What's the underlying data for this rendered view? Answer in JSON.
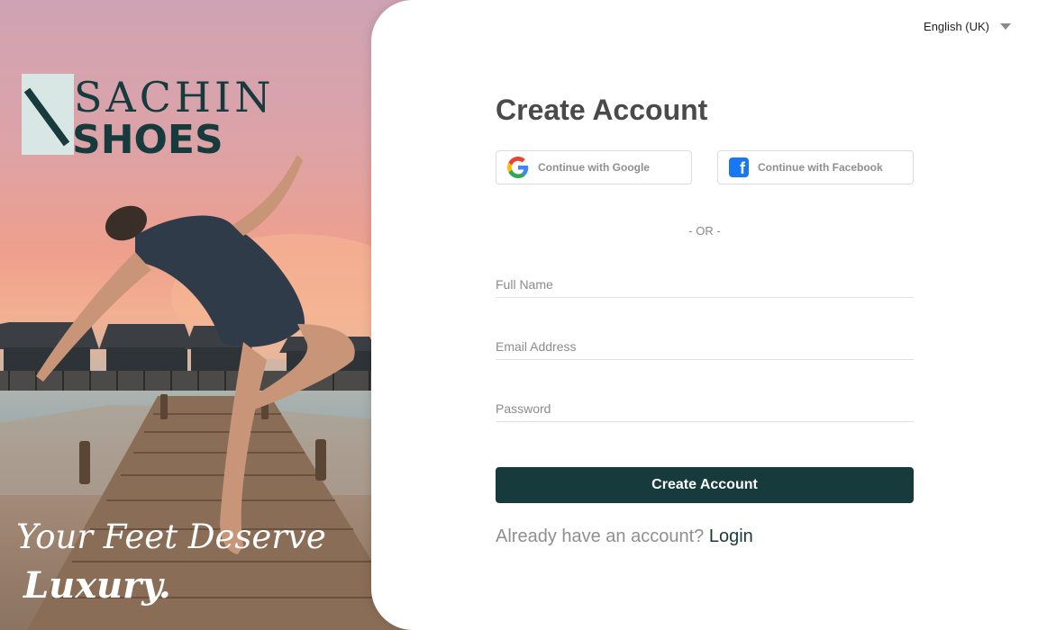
{
  "hero": {
    "brand": {
      "line1": "SACHIN",
      "line2": "SHOES",
      "color": "#173b3d",
      "accent": "#d8e6e4"
    },
    "tagline": {
      "line1": "Your Feet Deserve",
      "line2": "Luxury."
    }
  },
  "language": {
    "label": "English (UK)",
    "icon": "chevron-down-icon"
  },
  "form": {
    "title": "Create Account",
    "google_label": "Continue with Google",
    "facebook_label": "Continue with Facebook",
    "divider": "- OR -",
    "fields": {
      "full_name": {
        "placeholder": "Full Name",
        "value": ""
      },
      "email": {
        "placeholder": "Email Address",
        "value": ""
      },
      "password": {
        "placeholder": "Password",
        "value": ""
      }
    },
    "submit_label": "Create Account",
    "login_prompt": "Already have an account?",
    "login_link": "Login"
  },
  "colors": {
    "primary": "#173b3d",
    "facebook": "#1877f2"
  }
}
